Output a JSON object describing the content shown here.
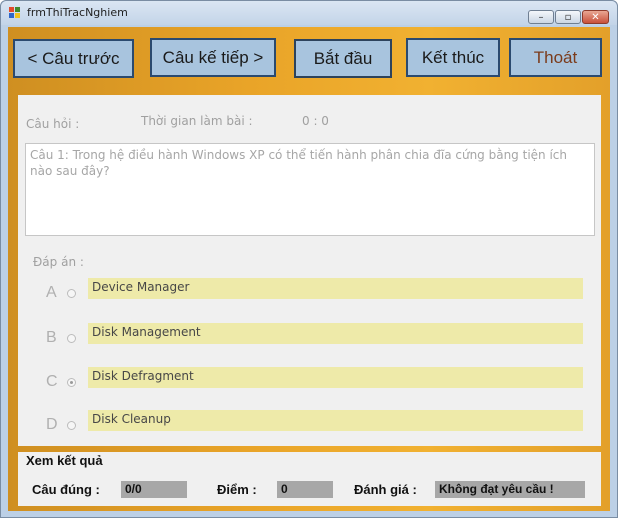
{
  "window": {
    "title": "frmThiTracNghiem"
  },
  "toolbar": {
    "prev_label": "< Câu trước",
    "next_label": "Câu kế tiếp >",
    "start_label": "Bắt đầu",
    "finish_label": "Kết thúc",
    "exit_label": "Thoát"
  },
  "question_panel": {
    "question_label": "Câu hỏi :",
    "time_label": "Thời gian làm bài :",
    "time_value": "0 : 0",
    "question_text": "Câu 1: Trong hệ điều hành Windows XP có thể tiến hành phân chia đĩa cứng bằng tiện ích nào sau đây?",
    "answers_label": "Đáp án :",
    "options": [
      {
        "letter": "A",
        "text": "Device Manager",
        "checked": false
      },
      {
        "letter": "B",
        "text": "Disk Management",
        "checked": false
      },
      {
        "letter": "C",
        "text": "Disk Defragment",
        "checked": true
      },
      {
        "letter": "D",
        "text": "Disk Cleanup",
        "checked": false
      }
    ]
  },
  "results": {
    "title": "Xem kết quả",
    "correct_label": "Câu đúng  :",
    "correct_value": "0/0",
    "score_label": "Điểm  :",
    "score_value": "0",
    "rating_label": "Đánh giá  :",
    "rating_value": "Không đạt yêu cầu !"
  },
  "colors": {
    "background": "#e9a428",
    "button": "#a8c4de",
    "option_bg": "#eeeaa9",
    "result_value_bg": "#a7a7a7"
  }
}
